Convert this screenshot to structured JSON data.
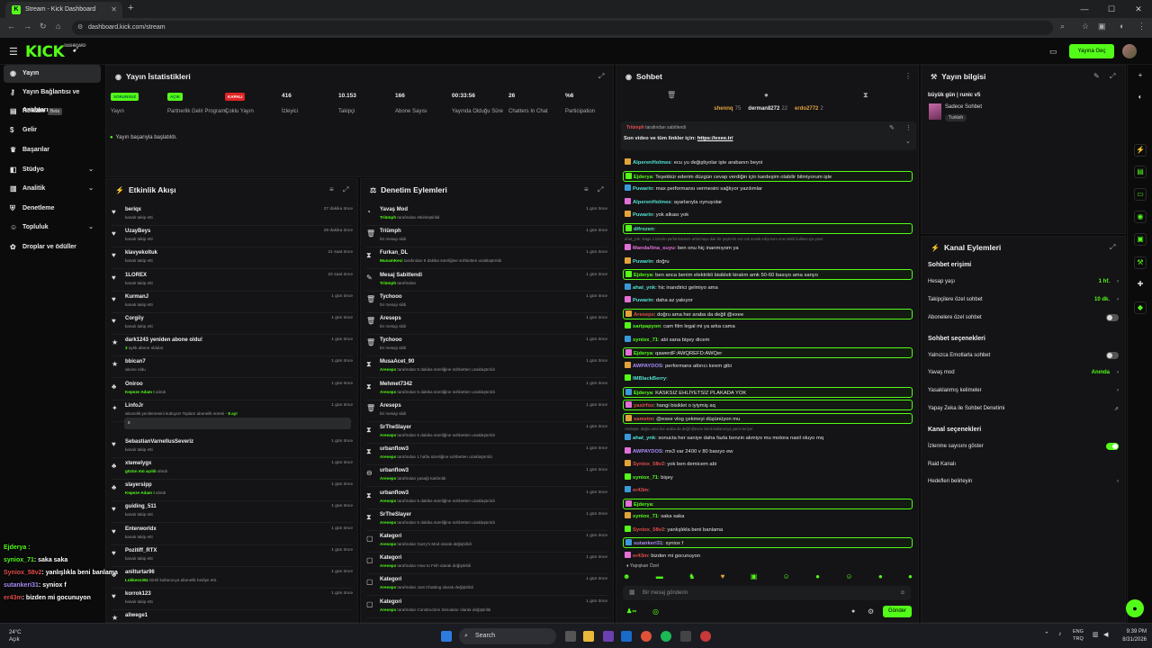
{
  "browser": {
    "tab_title": "Stream - Kick Dashboard",
    "url": "dashboard.kick.com/stream",
    "new_tab": "+"
  },
  "header": {
    "logo": "KICK",
    "logo_sup": "DASHBOARD",
    "go_live": "Yayına Geç"
  },
  "sidebar": {
    "items": [
      {
        "label": "Yayın",
        "icon": "stream-icon"
      },
      {
        "label": "Yayın Bağlantısı ve Anahtarı",
        "icon": "key-icon"
      },
      {
        "label": "Reklam",
        "icon": "ad-icon",
        "badge": "Beta"
      },
      {
        "label": "Gelir",
        "icon": "dollar-icon"
      },
      {
        "label": "Başarılar",
        "icon": "trophy-icon"
      },
      {
        "label": "Stüdyo",
        "icon": "studio-icon"
      },
      {
        "label": "Analitik",
        "icon": "chart-icon"
      },
      {
        "label": "Denetleme",
        "icon": "shield-icon"
      },
      {
        "label": "Topluluk",
        "icon": "community-icon"
      },
      {
        "label": "Droplar ve ödüller",
        "icon": "gift-icon"
      }
    ]
  },
  "stats": {
    "title": "Yayın İstatistikleri",
    "items": [
      {
        "value": "SORUNSUZ",
        "label": "Yayın",
        "pill": "green"
      },
      {
        "value": "AÇIK",
        "label": "Partnerlik Gelir Programı",
        "pill": "green"
      },
      {
        "value": "KAPALI",
        "label": "Çoklu Yayın",
        "pill": "red"
      },
      {
        "value": "416",
        "label": "İzleyici"
      },
      {
        "value": "10.153",
        "label": "Takipçi"
      },
      {
        "value": "166",
        "label": "Abone Sayısı"
      },
      {
        "value": "00:33:56",
        "label": "Yayında Olduğu Süre"
      },
      {
        "value": "26",
        "label": "Chatters In Chat"
      },
      {
        "value": "%6",
        "label": "Participation"
      }
    ],
    "status_message": "Yayın başarıyla başlatıldı."
  },
  "activity": {
    "title": "Etkinlik Akışı",
    "rows": [
      {
        "name": "beriqx",
        "sub": "kanalı takip etti",
        "time": "27 dakika önce",
        "icon": "heart-icon"
      },
      {
        "name": "UzayBeys",
        "sub": "kanalı takip etti",
        "time": "29 dakika önce",
        "icon": "heart-icon"
      },
      {
        "name": "klavyekoltuk",
        "sub": "kanalı takip etti",
        "time": "21 saat önce",
        "icon": "heart-icon"
      },
      {
        "name": "1LOREX",
        "sub": "kanalı takip etti",
        "time": "22 saat önce",
        "icon": "heart-icon"
      },
      {
        "name": "KurmanJ",
        "sub": "kanalı takip etti",
        "time": "1 gün önce",
        "icon": "heart-icon"
      },
      {
        "name": "Corgiiy",
        "sub": "kanalı takip etti",
        "time": "1 gün önce",
        "icon": "heart-icon"
      },
      {
        "name": "dark1243 yeniden abone oldu!",
        "sub_hl": "3",
        "sub": "aylık abone oldular",
        "time": "1 gün önce",
        "icon": "star-icon"
      },
      {
        "name": "bbican7",
        "sub": "abone oldu",
        "time": "1 gün önce",
        "icon": "star-icon"
      },
      {
        "name": "Oniroo",
        "sub_hl": "Kepeze Adam !",
        "sub": "alındı",
        "time": "1 gün önce",
        "icon": "gift-icon"
      },
      {
        "name": "LinfoJr",
        "sub": "abonelik yenilemesini kutluyor! Toplam abonelik süresi -",
        "sub_tail": "8 ay!",
        "time": "1 gün önce",
        "icon": "party-icon"
      },
      {
        "name": "SebastianVarnellusSeveriz",
        "sub": "kanalı takip etti",
        "time": "1 gün önce",
        "icon": "heart-icon"
      },
      {
        "name": "xtemelygx",
        "sub_hl": "gözün mü açıldı",
        "sub": "alındı",
        "time": "1 gün önce",
        "icon": "gift-icon"
      },
      {
        "name": "slayersipp",
        "sub_hl": "Kepeze Adam !",
        "sub": "alındı",
        "time": "1 gün önce",
        "icon": "gift-icon"
      },
      {
        "name": "guiding_511",
        "sub": "kanalı takip etti",
        "time": "1 gün önce",
        "icon": "heart-icon"
      },
      {
        "name": "Enterworldx",
        "sub": "kanalı takip etti",
        "time": "1 gün önce",
        "icon": "heart-icon"
      },
      {
        "name": "Pozitiff_RTX",
        "sub": "kanalı takip etti",
        "time": "1 gün önce",
        "icon": "heart-icon"
      },
      {
        "name": "anilturtar96",
        "sub_hl": "Lukkess35z",
        "sub": "isimli kullanıcıya abonelik hediye etti.",
        "time": "1 gün önce",
        "icon": "gift-icon"
      },
      {
        "name": "korrok123",
        "sub": "kanalı takip etti",
        "time": "1 gün önce",
        "icon": "heart-icon"
      },
      {
        "name": "aliwege1",
        "sub": "",
        "time": "",
        "icon": "star-icon"
      }
    ],
    "sub_input": "s"
  },
  "moderation": {
    "title": "Denetim Eylemleri",
    "rows": [
      {
        "name": "Yavaş Mod",
        "sub_hl": "Triümph",
        "sub": "tarafından etkinleştirildi",
        "time": "1 gün önce",
        "icon": "slow-icon"
      },
      {
        "name": "Triümph",
        "sub": "bir mesajı sildi",
        "time": "1 gün önce",
        "icon": "trash-icon"
      },
      {
        "name": "Furkan_DL",
        "sub_hl": "MusamKeci",
        "sub": "tarafından 5 dakika süreliğine sohbetten uzaklaştırıldı",
        "time": "1 gün önce",
        "icon": "timeout-icon"
      },
      {
        "name": "Mesaj Sabitlendi",
        "sub_hl": "Triümph",
        "sub": "tarafından",
        "time": "1 gün önce",
        "icon": "pin-icon"
      },
      {
        "name": "Tychooo",
        "sub": "bir mesajı sildi",
        "time": "1 gün önce",
        "icon": "trash-icon"
      },
      {
        "name": "Areseps",
        "sub": "bir mesajı sildi",
        "time": "1 gün önce",
        "icon": "trash-icon"
      },
      {
        "name": "Tychooo",
        "sub": "bir mesajı sildi",
        "time": "1 gün önce",
        "icon": "trash-icon"
      },
      {
        "name": "MusaAcet_90",
        "sub_hl": "Areseps",
        "sub": "tarafından 5 dakika süreliğine sohbetten uzaklaştırıldı",
        "time": "1 gün önce",
        "icon": "timeout-icon"
      },
      {
        "name": "Mehmet7342",
        "sub_hl": "Areseps",
        "sub": "tarafından 5 dakika süreliğine sohbetten uzaklaştırıldı",
        "time": "1 gün önce",
        "icon": "timeout-icon"
      },
      {
        "name": "Areseps",
        "sub": "bir mesajı sildi",
        "time": "1 gün önce",
        "icon": "trash-icon"
      },
      {
        "name": "SrTheSlayer",
        "sub_hl": "Areseps",
        "sub": "tarafından 5 dakika süreliğine sohbetten uzaklaştırıldı",
        "time": "1 gün önce",
        "icon": "timeout-icon"
      },
      {
        "name": "urbanflow3",
        "sub_hl": "Areseps",
        "sub": "tarafından 1 hafta süreliğine sohbetten uzaklaştırıldı",
        "time": "1 gün önce",
        "icon": "timeout-icon"
      },
      {
        "name": "urbanflow3",
        "sub_hl": "Areseps",
        "sub": "tarafından yasağı kaldırıldı",
        "time": "1 gün önce",
        "icon": "unban-icon"
      },
      {
        "name": "urbanflow3",
        "sub_hl": "Areseps",
        "sub": "tarafından 5 dakika süreliğine sohbetten uzaklaştırıldı",
        "time": "1 gün önce",
        "icon": "timeout-icon"
      },
      {
        "name": "SrTheSlayer",
        "sub_hl": "Areseps",
        "sub": "tarafından 5 dakika süreliğine sohbetten uzaklaştırıldı",
        "time": "1 gün önce",
        "icon": "timeout-icon"
      },
      {
        "name": "Kategori",
        "sub_hl": "Areseps",
        "sub": "tarafından Garry's Mod olarak değiştirildi",
        "time": "1 gün önce",
        "icon": "category-icon"
      },
      {
        "name": "Kategori",
        "sub_hl": "Areseps",
        "sub": "tarafından How to Fish olarak değiştirildi",
        "time": "1 gün önce",
        "icon": "category-icon"
      },
      {
        "name": "Kategori",
        "sub_hl": "Areseps",
        "sub": "tarafından Just Chatting olarak değiştirildi",
        "time": "1 gün önce",
        "icon": "category-icon"
      },
      {
        "name": "Kategori",
        "sub_hl": "Areseps",
        "sub": "tarafından Construction Simulator olarak değiştirildi",
        "time": "1 gün önce",
        "icon": "category-icon"
      }
    ]
  },
  "chat": {
    "title": "Sohbet",
    "top_users": [
      {
        "name": "shennq",
        "count": "75",
        "color": "#e3a33b"
      },
      {
        "name": "derman8272",
        "count": "22",
        "color": "#e6e6e6"
      },
      {
        "name": "erdo2772",
        "count": "2",
        "color": "#e3a33b"
      }
    ],
    "pinned_by": "tarafından sabitlendi",
    "pinned_text": "Son video ve tüm linkler için:",
    "pinned_link": "https://exee.tr/",
    "messages": [
      {
        "user": "AlperenHolmes",
        "color": "#53e0d0",
        "text": ": ecu yu değiştiyolar işte arabanın beyni",
        "hl": false
      },
      {
        "user": "Ejderya",
        "color": "#53fc18",
        "text": ": Teşekkür ederim düzgün cevap verdiğin için kardeşim olabilir bilmiyorum işte",
        "hl": true
      },
      {
        "user": "Puwarin",
        "color": "#53e0d0",
        "text": ": max performansı vermesini sağlıyor yazılımlar",
        "hl": false
      },
      {
        "user": "AlperenHolmes",
        "color": "#53e0d0",
        "text": ": ayarlarıyla oynuyolar",
        "hl": false
      },
      {
        "user": "Puwarin",
        "color": "#53e0d0",
        "text": ": yok alkası yok",
        "hl": false
      },
      {
        "user": "difrozen",
        "color": "#53e0d0",
        "text": ":",
        "hl": true
      },
      {
        "user": "",
        "color": "#777",
        "text": "ahat_ynk: stage 1 benzin performansını arttırmaya dair bir şeylerini var cok marak ediyorum enw isimli kullanıcıya yanıt",
        "sys": true
      },
      {
        "user": "Manda/lina_suyu",
        "color": "#e36fd8",
        "text": ": ben onu hiç inanmıyom ya",
        "hl": false
      },
      {
        "user": "Puwarin",
        "color": "#53e0d0",
        "text": ": doğru",
        "hl": false
      },
      {
        "user": "Ejderya",
        "color": "#53fc18",
        "text": ": ben anca benim elektrikli bisikleti kiralım amk 50-60 basıyo ama sanyo",
        "hl": true
      },
      {
        "user": "ahat_ynk",
        "color": "#53e0d0",
        "text": ": hic inandirici gelmiyo ama",
        "hl": false
      },
      {
        "user": "Puwarin",
        "color": "#53e0d0",
        "text": ": daha az yakıyor",
        "hl": false
      },
      {
        "user": "Areseps",
        "color": "#e34c4c",
        "text": ": doğru ama her araba da değil @exee",
        "hl": true
      },
      {
        "user": "saripapyon",
        "color": "#53fc18",
        "text": ": cam film legal mi ya arka cama",
        "hl": false
      },
      {
        "user": "syniox_71",
        "color": "#53fc18",
        "text": ": abi sana bişey dicem",
        "hl": false
      },
      {
        "user": "Ejderya",
        "color": "#53fc18",
        "text": ": qawerdF:AWQREFD:AWQer",
        "hl": true
      },
      {
        "user": "AWPAYDOS",
        "color": "#a98cf6",
        "text": ": performans attırıcı kırem gibi",
        "hl": false
      },
      {
        "user": "IMBlackBerry",
        "color": "#53e0d0",
        "text": ":",
        "hl": false
      },
      {
        "user": "Ejderya",
        "color": "#53fc18",
        "text": ": KASKSIZ EHLİYETSİZ PLAKADA YOK",
        "hl": true
      },
      {
        "user": "yasirfox",
        "color": "#e34c4c",
        "text": ": hangi bisiklet o iyiymiş aq",
        "hl": true
      },
      {
        "user": "sametm",
        "color": "#e34c4c",
        "text": ": @exee vlog çekmeyi düşünüyon mu",
        "hl": true
      },
      {
        "user": "",
        "color": "#777",
        "text": "Areseps: doğru ama her araba da değil @exee isimli kullanıcıya yanıt veriyor",
        "sys": true
      },
      {
        "user": "ahat_ynk",
        "color": "#53e0d0",
        "text": ": sonucta her saniye daha fazla benzin akmiyo mu motora nasil oluyo mq",
        "hl": false
      },
      {
        "user": "AWPAYDOS",
        "color": "#a98cf6",
        "text": ": mx3 var 2400 v 80 basıyo ew",
        "hl": false
      },
      {
        "user": "Syniox_58v2",
        "color": "#e34c4c",
        "text": ": yok ben demicem abi",
        "hl": false
      },
      {
        "user": "syniox_71",
        "color": "#53fc18",
        "text": ": bişey",
        "hl": false
      },
      {
        "user": "er43m",
        "color": "#e34c4c",
        "text": ":",
        "hl": false
      },
      {
        "user": "Ejderya",
        "color": "#53fc18",
        "text": ":",
        "hl": true
      },
      {
        "user": "syniox_71",
        "color": "#53fc18",
        "text": ": saka saka",
        "hl": false
      },
      {
        "user": "Syniox_58v2",
        "color": "#e34c4c",
        "text": ": yanlışlıkla beni banlama",
        "hl": false
      },
      {
        "user": "sutankeri31",
        "color": "#a98cf6",
        "text": ": syniox f",
        "hl": true
      },
      {
        "user": "er43m",
        "color": "#e34c4c",
        "text": ": bizden mi gocunuyon",
        "hl": false
      }
    ],
    "emote_label": "Yapışkan Özel",
    "input_placeholder": "Bir mesaj gönderin",
    "send": "Gönder",
    "infinity": "∞"
  },
  "stream_info": {
    "title": "Yayın bilgisi",
    "stream_title": "büyük gün | runic v5",
    "category": "Sadece Sohbet",
    "tag": "Turkish"
  },
  "channel_actions": {
    "title": "Kanal Eylemleri",
    "chat_access": "Sohbet erişimi",
    "account_age": {
      "label": "Hesap yaşı",
      "value": "1 hf."
    },
    "followers_chat": {
      "label": "Takipçilere özel sohbet",
      "value": "10 dk."
    },
    "subs_chat": {
      "label": "Abonelere özel sohbet"
    },
    "chat_options": "Sohbet seçenekleri",
    "emotes_only": {
      "label": "Yalnızca Emotlarla sohbet"
    },
    "slow_mode": {
      "label": "Yavaş mod",
      "value": "Anında"
    },
    "banned_words": {
      "label": "Yasaklanmış kelimeler"
    },
    "ai_moderation": {
      "label": "Yapay Zeka ile Sohbet Denetimi"
    },
    "channel_options": "Kanal seçenekleri",
    "show_viewers": {
      "label": "İzlenme sayısını göster"
    },
    "raid": {
      "label": "Raid Kanalı"
    },
    "targets": {
      "label": "Hedefleri belirleyin"
    }
  },
  "overlay_chat": [
    {
      "user": "Ejderya :",
      "text": "",
      "color": "#53fc18"
    },
    {
      "user": "syniox_71",
      "text": ": saka saka",
      "color": "#53fc18"
    },
    {
      "user": "Syniox_58v2",
      "text": ": yanlışlıkla beni banlama",
      "color": "#e34c4c"
    },
    {
      "user": "sutankeri31",
      "text": ": syniox f",
      "color": "#a98cf6"
    },
    {
      "user": "er43m",
      "text": ": bizden mi gocunuyon",
      "color": "#e34c4c"
    }
  ],
  "taskbar": {
    "temp": "24°C",
    "weather": "Açık",
    "search": "Search",
    "lang1": "ENG",
    "lang2": "TRQ",
    "time": "9:39 PM",
    "date": "8/31/2026"
  }
}
